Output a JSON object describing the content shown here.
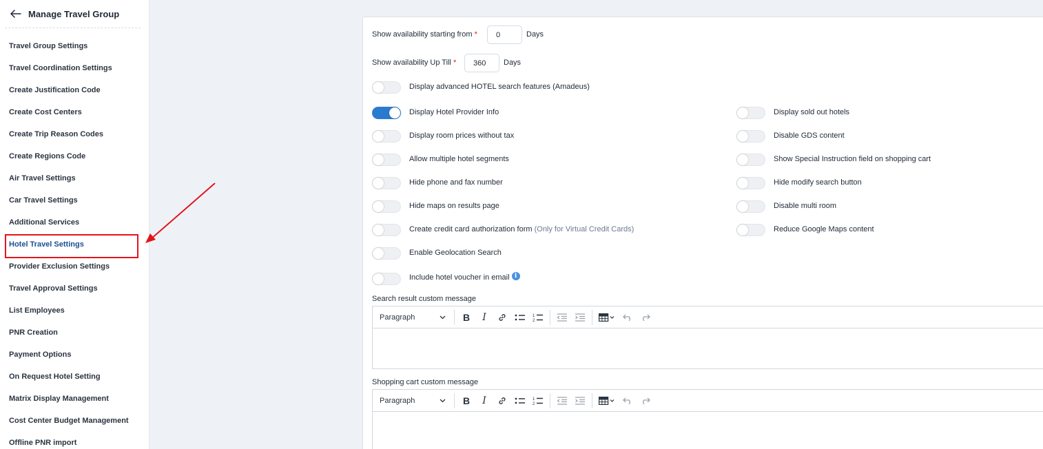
{
  "sidebar": {
    "title": "Manage Travel Group",
    "items": [
      {
        "label": "Travel Group Settings"
      },
      {
        "label": "Travel Coordination Settings"
      },
      {
        "label": "Create Justification Code"
      },
      {
        "label": "Create Cost Centers"
      },
      {
        "label": "Create Trip Reason Codes"
      },
      {
        "label": "Create Regions Code"
      },
      {
        "label": "Air Travel Settings"
      },
      {
        "label": "Car Travel Settings"
      },
      {
        "label": "Additional Services"
      },
      {
        "label": "Hotel Travel Settings"
      },
      {
        "label": "Provider Exclusion Settings"
      },
      {
        "label": "Travel Approval Settings"
      },
      {
        "label": "List Employees"
      },
      {
        "label": "PNR Creation"
      },
      {
        "label": "Payment Options"
      },
      {
        "label": "On Request Hotel Setting"
      },
      {
        "label": "Matrix Display Management"
      },
      {
        "label": "Cost Center Budget Management"
      },
      {
        "label": "Offline PNR import"
      }
    ],
    "active_item": "Hotel Travel Settings"
  },
  "form": {
    "avail_from": {
      "label": "Show availability starting from",
      "required": "*",
      "value": "0",
      "unit": "Days"
    },
    "avail_till": {
      "label": "Show availability Up Till",
      "required": "*",
      "value": "360",
      "unit": "Days"
    },
    "advanced_search": {
      "label": "Display advanced HOTEL search features (Amadeus)",
      "on": false
    },
    "left_toggles": [
      {
        "label": "Display Hotel Provider Info",
        "on": true
      },
      {
        "label": "Display room prices without tax",
        "on": false
      },
      {
        "label": "Allow multiple hotel segments",
        "on": false
      },
      {
        "label": "Hide phone and fax number",
        "on": false
      },
      {
        "label": "Hide maps on results page",
        "on": false
      },
      {
        "label": "Create credit card authorization form",
        "note": "(Only for Virtual Credit Cards)",
        "on": false
      },
      {
        "label": "Enable Geolocation Search",
        "on": false
      },
      {
        "label": "Include hotel voucher in email",
        "on": false
      }
    ],
    "right_toggles": [
      {
        "label": "Display sold out hotels",
        "on": false
      },
      {
        "label": "Disable GDS content",
        "on": false
      },
      {
        "label": "Show Special Instruction field on shopping cart",
        "on": false
      },
      {
        "label": "Hide modify search button",
        "on": false
      },
      {
        "label": "Disable multi room",
        "on": false
      },
      {
        "label": "Reduce Google Maps content",
        "on": false
      }
    ]
  },
  "editors": [
    {
      "label": "Search result custom message",
      "format": "Paragraph"
    },
    {
      "label": "Shopping cart custom message",
      "format": "Paragraph"
    }
  ],
  "icons": {
    "info": "i",
    "bold": "B",
    "italic": "I"
  },
  "colors": {
    "accent": "#2a7bd0",
    "required": "#e3141a",
    "annotation": "#e3141a",
    "active_nav": "#1d4f91"
  }
}
